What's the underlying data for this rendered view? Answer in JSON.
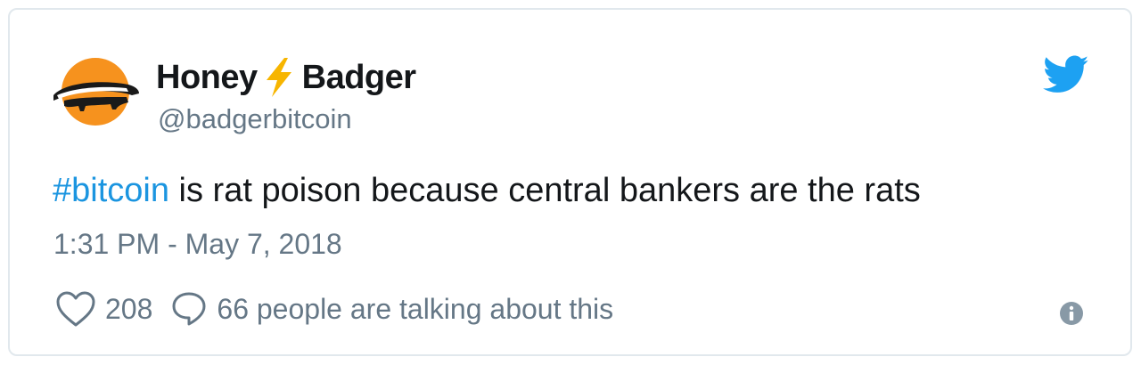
{
  "tweet": {
    "display_name_first": "Honey",
    "display_name_second": "Badger",
    "handle": "@badgerbitcoin",
    "text_hashtag": "#bitcoin",
    "text_body": " is rat poison because central bankers are the rats",
    "timestamp": "1:31 PM - May 7, 2018",
    "like_count": "208",
    "talking_text": "66 people are talking about this"
  },
  "icons": {
    "avatar": "honey-badger-avatar",
    "bolt": "lightning-bolt-emoji",
    "brand": "twitter-bird-icon",
    "like": "heart-icon",
    "reply": "speech-bubble-icon",
    "info": "info-icon"
  },
  "colors": {
    "twitter_blue": "#1da1f2",
    "hashtag_blue": "#1b95e0",
    "text_primary": "#14171a",
    "text_secondary": "#657786",
    "avatar_orange": "#f6921e",
    "bolt_yellow": "#f7b500",
    "border": "#e1e8ed"
  }
}
